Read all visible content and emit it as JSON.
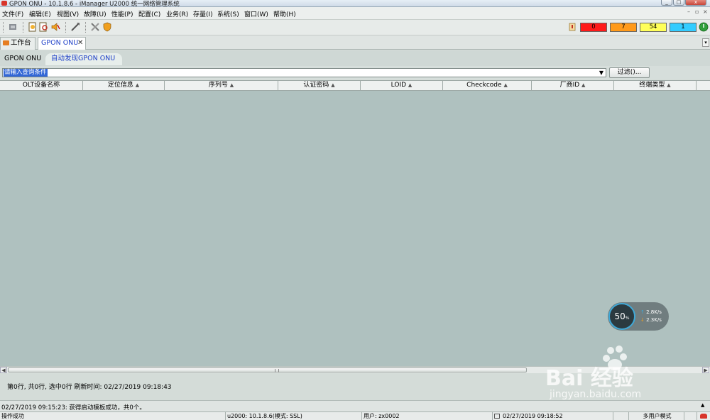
{
  "window": {
    "title": "GPON ONU - 10.1.8.6 - iManager U2000 统一网络管理系统"
  },
  "menu": [
    {
      "label": "文件(F)"
    },
    {
      "label": "编辑(E)"
    },
    {
      "label": "视图(V)"
    },
    {
      "label": "故障(U)"
    },
    {
      "label": "性能(P)"
    },
    {
      "label": "配置(C)"
    },
    {
      "label": "业务(R)"
    },
    {
      "label": "存量(I)"
    },
    {
      "label": "系统(S)"
    },
    {
      "label": "窗口(W)"
    },
    {
      "label": "帮助(H)"
    }
  ],
  "alarms": [
    {
      "count": "0",
      "color": "#ff1a1a"
    },
    {
      "count": "7",
      "color": "#ff9a1a"
    },
    {
      "count": "54",
      "color": "#ffff59"
    },
    {
      "count": "1",
      "color": "#33ccff"
    }
  ],
  "tabs": {
    "workbench": "工作台",
    "gpon_onu": "GPON ONU"
  },
  "subtabs": {
    "first": "GPON ONU",
    "second": "自动发现GPON ONU"
  },
  "search": {
    "value": "请输入查询条件",
    "filter_button": "过滤()..."
  },
  "table": {
    "columns": [
      {
        "label": "OLT设备名称",
        "sortable": false
      },
      {
        "label": "定位信息",
        "sortable": true
      },
      {
        "label": "序列号",
        "sortable": true
      },
      {
        "label": "认证密码",
        "sortable": true
      },
      {
        "label": "LOID",
        "sortable": true
      },
      {
        "label": "Checkcode",
        "sortable": true
      },
      {
        "label": "厂商ID",
        "sortable": true
      },
      {
        "label": "终端类型",
        "sortable": true
      }
    ]
  },
  "summary": {
    "text": "第0行, 共0行, 选中0行   刷新时间: 02/27/2019 09:18:43"
  },
  "log": {
    "text": "02/27/2019 09:15:23: 获得启动模板成功，共0个。"
  },
  "status": {
    "message": "操作成功",
    "server": "u2000: 10.1.8.6(模式: SSL)",
    "user": "用户: zx0002",
    "time": "02/27/2019 09:18:52",
    "mode": "多用户模式"
  },
  "network_widget": {
    "percent": "50",
    "unit": "%",
    "upload": "2.8K/s",
    "download": "2.3K/s"
  },
  "watermark": {
    "brand": "Bai 经验",
    "url": "jingyan.baidu.com"
  }
}
